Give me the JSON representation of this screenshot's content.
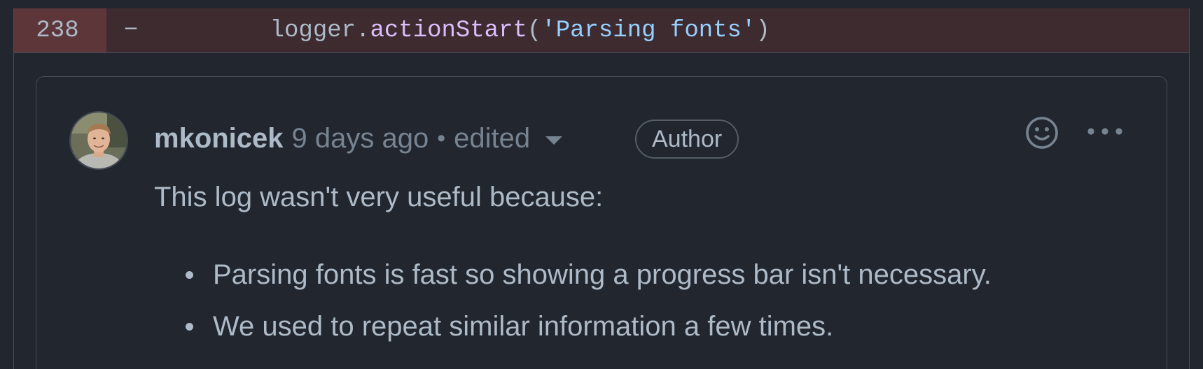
{
  "diff": {
    "line_number": "238",
    "marker": "−",
    "code": {
      "indent": "    ",
      "object": "logger.",
      "method": "actionStart",
      "open": "(",
      "string": "'Parsing fonts'",
      "close": ")"
    }
  },
  "comment": {
    "author": "mkonicek",
    "timestamp": "9 days ago",
    "separator": "•",
    "edited_label": "edited",
    "badge": "Author",
    "body_intro": "This log wasn't very useful because:",
    "bullets": [
      "Parsing fonts is fast so showing a progress bar isn't necessary.",
      "We used to repeat similar information a few times."
    ]
  },
  "icons": {
    "reaction": "smiley-icon",
    "more": "kebab-horizontal-icon",
    "edited_dropdown": "triangle-down-icon"
  },
  "colors": {
    "background": "#22262e",
    "deleted_row": "#3e2b30",
    "deleted_line_number": "#5d3639",
    "text": "#adbac7",
    "muted": "#768390",
    "string": "#96d0ff",
    "function": "#dcbdfb"
  }
}
